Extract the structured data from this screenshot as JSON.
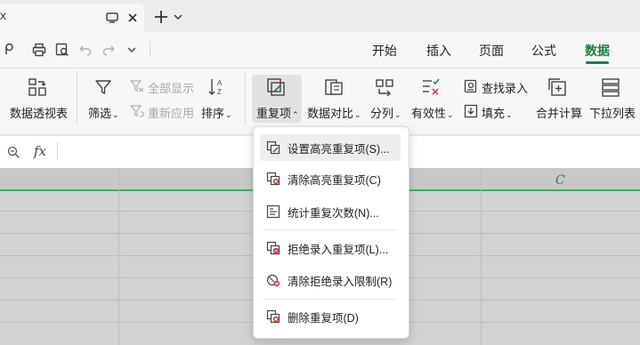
{
  "titlebar": {
    "tab_title": "x"
  },
  "menu": {
    "tabs": [
      {
        "label": "开始"
      },
      {
        "label": "插入"
      },
      {
        "label": "页面"
      },
      {
        "label": "公式"
      },
      {
        "label": "数据"
      }
    ],
    "active_tab": "数据"
  },
  "ribbon": {
    "pivot_table": "数据透视表",
    "filter": "筛选",
    "show_all": "全部显示",
    "reapply": "重新应用",
    "sort": "排序",
    "duplicates": "重复项",
    "data_compare": "数据对比",
    "split": "分列",
    "validity": "有效性",
    "find_entry": "查找录入",
    "fill": "填充",
    "consolidate": "合并计算",
    "dropdown_list": "下拉列表"
  },
  "formula_bar": {
    "fx": "fx"
  },
  "sheet": {
    "column_c": "C"
  },
  "dropdown": {
    "items": [
      {
        "label": "设置高亮重复项(S)...",
        "icon": "highlight-duplicates-icon"
      },
      {
        "label": "清除高亮重复项(C)",
        "icon": "clear-highlight-icon"
      },
      {
        "label": "统计重复次数(N)...",
        "icon": "count-duplicates-icon"
      },
      {
        "label": "拒绝录入重复项(L)...",
        "icon": "reject-duplicates-icon"
      },
      {
        "label": "清除拒绝录入限制(R)",
        "icon": "clear-reject-icon"
      },
      {
        "label": "删除重复项(D)",
        "icon": "delete-duplicates-icon"
      }
    ]
  },
  "colors": {
    "accent": "#1e7d45",
    "grid_selection": "#3cb553"
  }
}
